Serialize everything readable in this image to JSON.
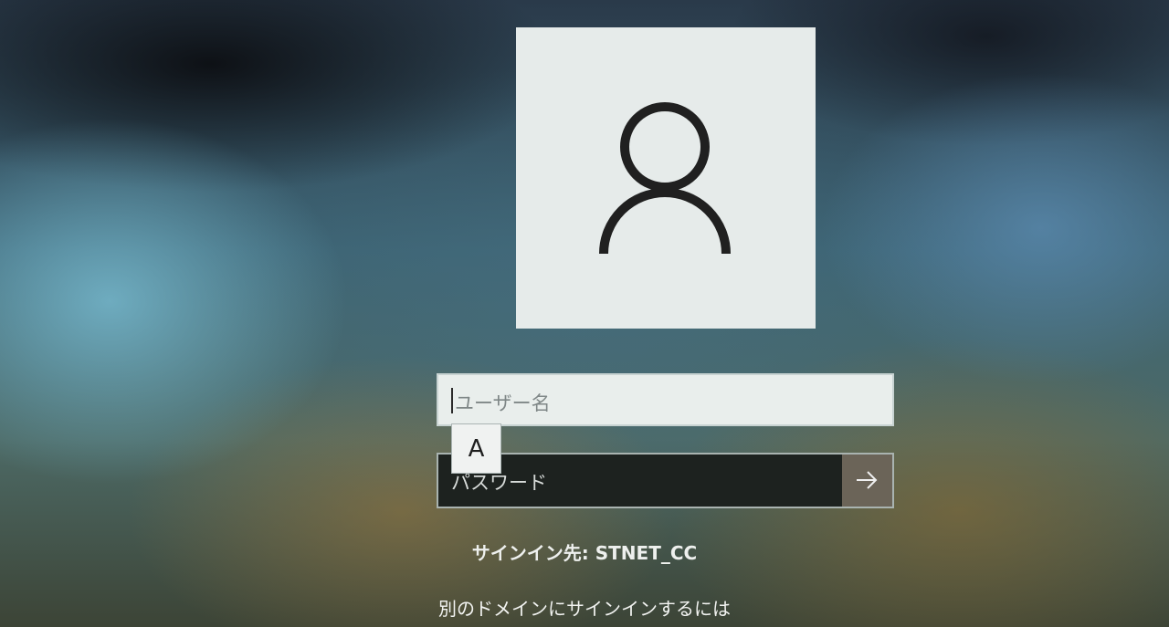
{
  "login": {
    "username_placeholder": "ユーザー名",
    "ime_mode": "A",
    "password_placeholder": "パスワード",
    "sign_in_to": "サインイン先: STNET_CC",
    "other_domain_link": "別のドメインにサインインするには"
  },
  "icons": {
    "avatar": "user-avatar-icon",
    "submit": "arrow-right-icon"
  },
  "colors": {
    "avatar_tile": "#e6ebea",
    "username_field": "#e9eeec",
    "password_field": "#1d221f",
    "submit_button": "#6b6458",
    "text_light": "#eef0ee"
  }
}
